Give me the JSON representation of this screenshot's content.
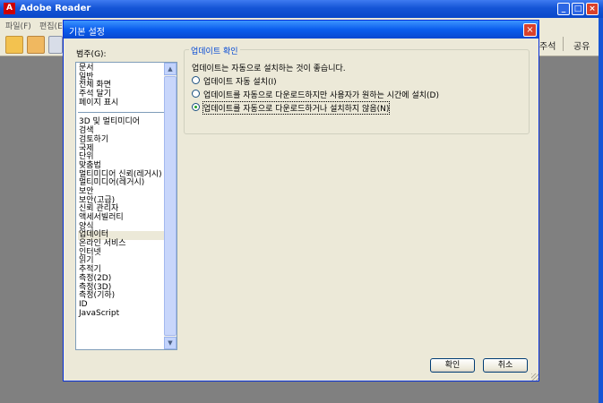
{
  "app": {
    "title": "Adobe Reader",
    "logo_glyph": "A",
    "window_buttons": {
      "minimize": "_",
      "maximize": "□",
      "close": "×"
    },
    "menu": [
      "파일(F)",
      "편집(E)"
    ],
    "toolbar_right": [
      "주석",
      "공유"
    ]
  },
  "dialog": {
    "title": "기본 설정",
    "close_glyph": "×",
    "categories_label": "범주(G):",
    "categories_top": [
      "문서",
      "일반",
      "전체 화면",
      "주석 달기",
      "페이지 표시"
    ],
    "categories_bottom": [
      "3D 및 멀티미디어",
      "검색",
      "검토하기",
      "국제",
      "단위",
      "맞춤법",
      "멀티미디어 신뢰(레거시)",
      "멀티미디어(레거시)",
      "보안",
      "보안(고급)",
      "신뢰 관리자",
      "액세서빌러티",
      "양식",
      "업데이터",
      "온라인 서비스",
      "인터넷",
      "읽기",
      "추적기",
      "측정(2D)",
      "측정(3D)",
      "측정(기하)",
      "ID",
      "JavaScript"
    ],
    "selected_category": "업데이터",
    "scroll_up_glyph": "▲",
    "scroll_down_glyph": "▼",
    "group_title": "업데이트 확인",
    "group_description": "업데이트는 자동으로 설치하는 것이 좋습니다.",
    "options": [
      {
        "label": "업데이트 자동 설치(I)",
        "checked": false
      },
      {
        "label": "업데이트를 자동으로 다운로드하지만 사용자가 원하는 시간에 설치(D)",
        "checked": false
      },
      {
        "label": "업데이트를 자동으로 다운로드하거나 설치하지 않음(N)",
        "checked": true
      }
    ],
    "ok_label": "확인",
    "cancel_label": "취소"
  },
  "colors": {
    "titlebar": "#0a5ded",
    "dialog_bg": "#ece9d8",
    "group_title": "#0046d5",
    "radio_dot": "#21a121"
  }
}
